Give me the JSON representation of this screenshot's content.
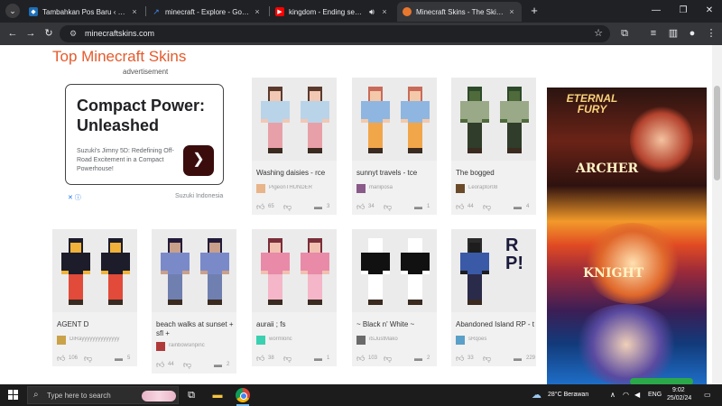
{
  "browser": {
    "tabs": [
      {
        "title": "Tambahkan Pos Baru ‹ Dafunda",
        "favicon": "dafunda-icon",
        "active": false
      },
      {
        "title": "minecraft - Explore - Google Tr",
        "favicon": "google-trends-icon",
        "active": false
      },
      {
        "title": "kingdom - Ending season",
        "favicon": "youtube-icon",
        "active": false,
        "audio": true
      },
      {
        "title": "Minecraft Skins - The Skindex",
        "favicon": "skindex-icon",
        "active": true
      }
    ],
    "url": "minecraftskins.com",
    "close_glyph": "×",
    "new_tab_glyph": "+"
  },
  "page": {
    "title": "Top Minecraft Skins",
    "advertisement_label": "advertisement",
    "ad": {
      "headline": "Compact Power: Unleashed",
      "body": "Suzuki's Jimny 5D: Redefining Off-Road Excitement in a Compact Powerhouse!",
      "sponsor": "Suzuki Indonesia",
      "cta_glyph": "❯",
      "adchoices": "✕ ⓘ"
    },
    "skins": [
      {
        "name": "Washing daisies - rce",
        "author": "PigeonTHUNDER",
        "likes": "65",
        "comments": "3",
        "colors": [
          "#5b3a2e",
          "#f2c7b4",
          "#b9d4e8",
          "#e8a0a8"
        ],
        "avatar_color": "#e8b48a"
      },
      {
        "name": "sunnyt travels - tce",
        "author": "mariiposa",
        "likes": "34",
        "comments": "1",
        "colors": [
          "#c96b5a",
          "#f4c9a9",
          "#8fb6e0",
          "#f2a64a"
        ],
        "avatar_color": "#8a5a8a"
      },
      {
        "name": "The bogged",
        "author": "Leoraptor08",
        "likes": "44",
        "comments": "4",
        "colors": [
          "#2d4a2a",
          "#4f6a3b",
          "#9aa987",
          "#2f3d2a"
        ],
        "avatar_color": "#6b4a2a"
      },
      {
        "name": "AGENT D",
        "author": "DiRayyyyyyyyyyyyyy",
        "likes": "106",
        "comments": "5",
        "colors": [
          "#1c1c2a",
          "#f0b23a",
          "#1c1c2a",
          "#e24a3a"
        ],
        "avatar_color": "#caa24a"
      },
      {
        "name": "beach walks at sunset + sfl +",
        "author": "rainbowsinpinc",
        "likes": "44",
        "comments": "2",
        "colors": [
          "#241c3a",
          "#c9a08a",
          "#7a8ac9",
          "#6f7fb0"
        ],
        "avatar_color": "#b03a3a"
      },
      {
        "name": "auraii ; fs",
        "author": "wormlonc",
        "likes": "38",
        "comments": "1",
        "colors": [
          "#7a2f3a",
          "#f2c0b0",
          "#e88aa8",
          "#f4b6c8"
        ],
        "avatar_color": "#3ad0b0"
      },
      {
        "name": "~ Black n' White ~",
        "author": "itsJustMako",
        "likes": "103",
        "comments": "2",
        "colors": [
          "#ffffff",
          "#ffffff",
          "#111111",
          "#ffffff"
        ],
        "avatar_color": "#6a6a6a"
      },
      {
        "name": "Abandoned Island RP - t",
        "author": "sRqoes",
        "likes": "33",
        "comments": "229",
        "colors": [
          "#2b2b2b",
          "#1d1d1d",
          "#3a5aa8",
          "#2a2a4a"
        ],
        "avatar_color": "#5aa0c8",
        "rp_text": "RP!"
      }
    ],
    "side_ad": {
      "logo": "ETERNAL FURY",
      "class_1": "ARCHER",
      "class_2": "KNIGHT"
    }
  },
  "taskbar": {
    "search_placeholder": "Type here to search",
    "weather": "28°C  Berawan",
    "language": "ENG",
    "time": "9:02",
    "date": "25/02/24"
  }
}
